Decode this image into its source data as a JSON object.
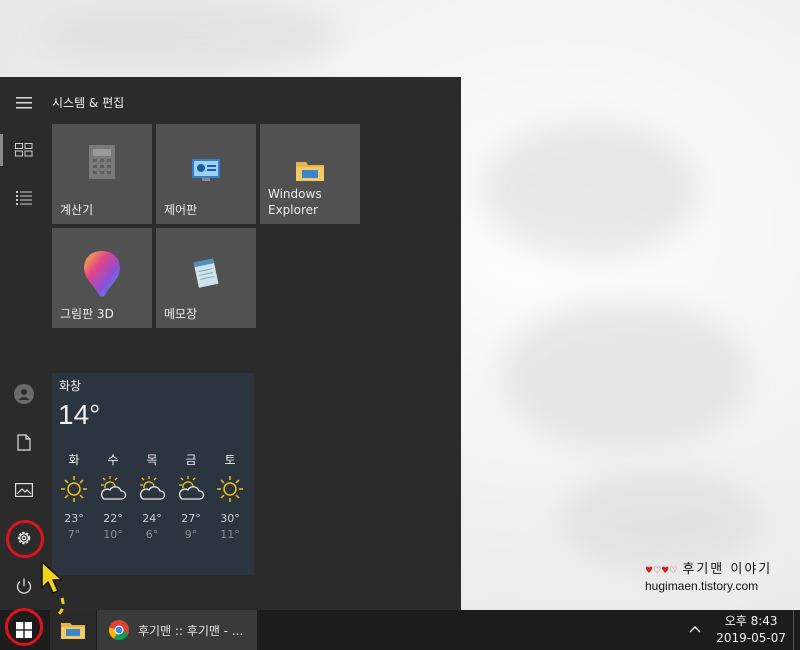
{
  "start_menu": {
    "group_title": "시스템 & 편집",
    "tiles": [
      {
        "label": "계산기",
        "icon": "calculator-icon"
      },
      {
        "label": "제어판",
        "icon": "control-panel-icon"
      },
      {
        "label": "Windows Explorer",
        "icon": "folder-icon"
      },
      {
        "label": "그림판 3D",
        "icon": "paint-3d-icon"
      },
      {
        "label": "메모장",
        "icon": "notepad-icon"
      }
    ],
    "rail_icons": [
      "hamburger-menu-icon",
      "tiles-icon",
      "all-apps-list-icon",
      "user-account-icon",
      "documents-icon",
      "pictures-icon",
      "settings-gear-icon",
      "power-icon"
    ],
    "weather": {
      "city": "화창",
      "current_temp": "14°",
      "forecast": [
        {
          "day": "화",
          "high": "23°",
          "low": "7°",
          "icon": "sunny-icon"
        },
        {
          "day": "수",
          "high": "22°",
          "low": "10°",
          "icon": "partly-cloudy-icon"
        },
        {
          "day": "목",
          "high": "24°",
          "low": "6°",
          "icon": "partly-cloudy-icon"
        },
        {
          "day": "금",
          "high": "27°",
          "low": "9°",
          "icon": "partly-cloudy-icon"
        },
        {
          "day": "토",
          "high": "30°",
          "low": "11°",
          "icon": "sunny-icon"
        }
      ]
    }
  },
  "taskbar": {
    "chrome_task_label": "후기맨 :: 후기맨 - ...",
    "time": "오후 8:43",
    "date": "2019-05-07"
  },
  "watermark": {
    "hearts": "♥♡♥♡",
    "name": "후기맨 이야기",
    "url": "hugimaen.tistory.com"
  },
  "colors": {
    "start_bg": "#2b2b2b",
    "tile_bg": "#515151",
    "highlight_ring": "#e0121b",
    "arrow": "#f2d21b"
  }
}
